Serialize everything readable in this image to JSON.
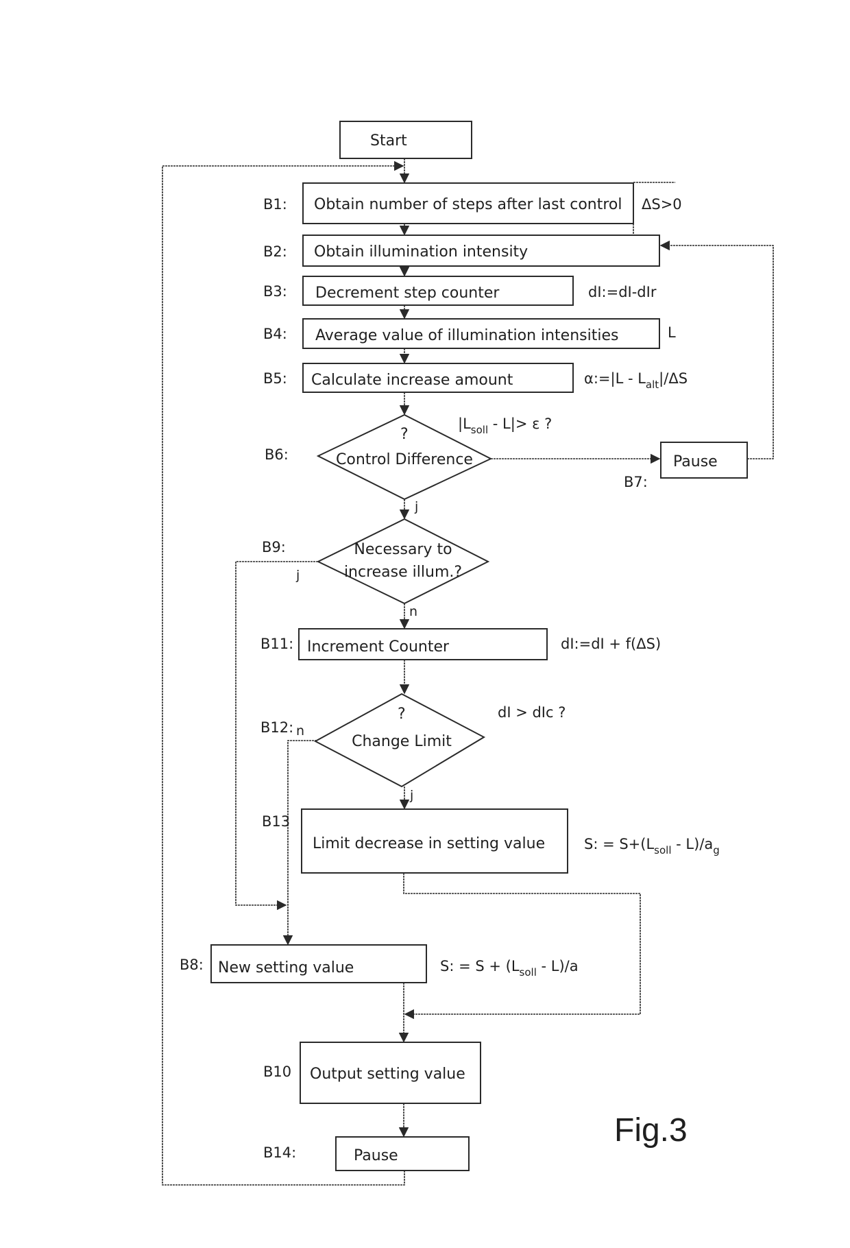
{
  "figure_label": "Fig.3",
  "nodes": {
    "start": {
      "text": "Start"
    },
    "b1": {
      "label": "B1:",
      "text": "Obtain number of steps after last control",
      "formula": "ΔS>0"
    },
    "b2": {
      "label": "B2:",
      "text": "Obtain illumination intensity"
    },
    "b3": {
      "label": "B3:",
      "text": "Decrement step counter",
      "formula": "dI:=dI-dIr"
    },
    "b4": {
      "label": "B4:",
      "text": "Average value of illumination intensities",
      "formula": "L"
    },
    "b5": {
      "label": "B5:",
      "text": "Calculate increase amount",
      "formula_main": "α:=|L - L",
      "formula_sub": "alt",
      "formula_tail": "|/ΔS"
    },
    "b6": {
      "label": "B6:",
      "text": "Control Difference",
      "question": "?",
      "formula_main": "|L",
      "formula_sub": "soll",
      "formula_tail": " - L|> ε ?",
      "yes_branch": "j"
    },
    "b7": {
      "label": "B7:",
      "text": "Pause"
    },
    "b9": {
      "label": "B9:",
      "text_line1": "Necessary to",
      "text_line2": "increase illum.?",
      "yes_branch": "j",
      "no_branch": "n"
    },
    "b11": {
      "label": "B11:",
      "text": "Increment Counter",
      "formula": "dI:=dI + f(ΔS)"
    },
    "b12": {
      "label": "B12:",
      "text": "Change Limit",
      "question": "?",
      "formula": "dI > dIc ?",
      "yes_branch": "j",
      "no_branch": "n"
    },
    "b13": {
      "label": "B13",
      "text": "Limit decrease in setting value",
      "formula_main": "S: = S+(L",
      "formula_sub": "soll",
      "formula_tail": " - L)/a",
      "formula_tail_sub": "g"
    },
    "b8": {
      "label": "B8:",
      "text": "New setting value",
      "formula_main": "S: = S + (L",
      "formula_sub": "soll",
      "formula_tail": " - L)/a"
    },
    "b10": {
      "label": "B10",
      "text": "Output setting value"
    },
    "b14": {
      "label": "B14:",
      "text": "Pause"
    }
  }
}
